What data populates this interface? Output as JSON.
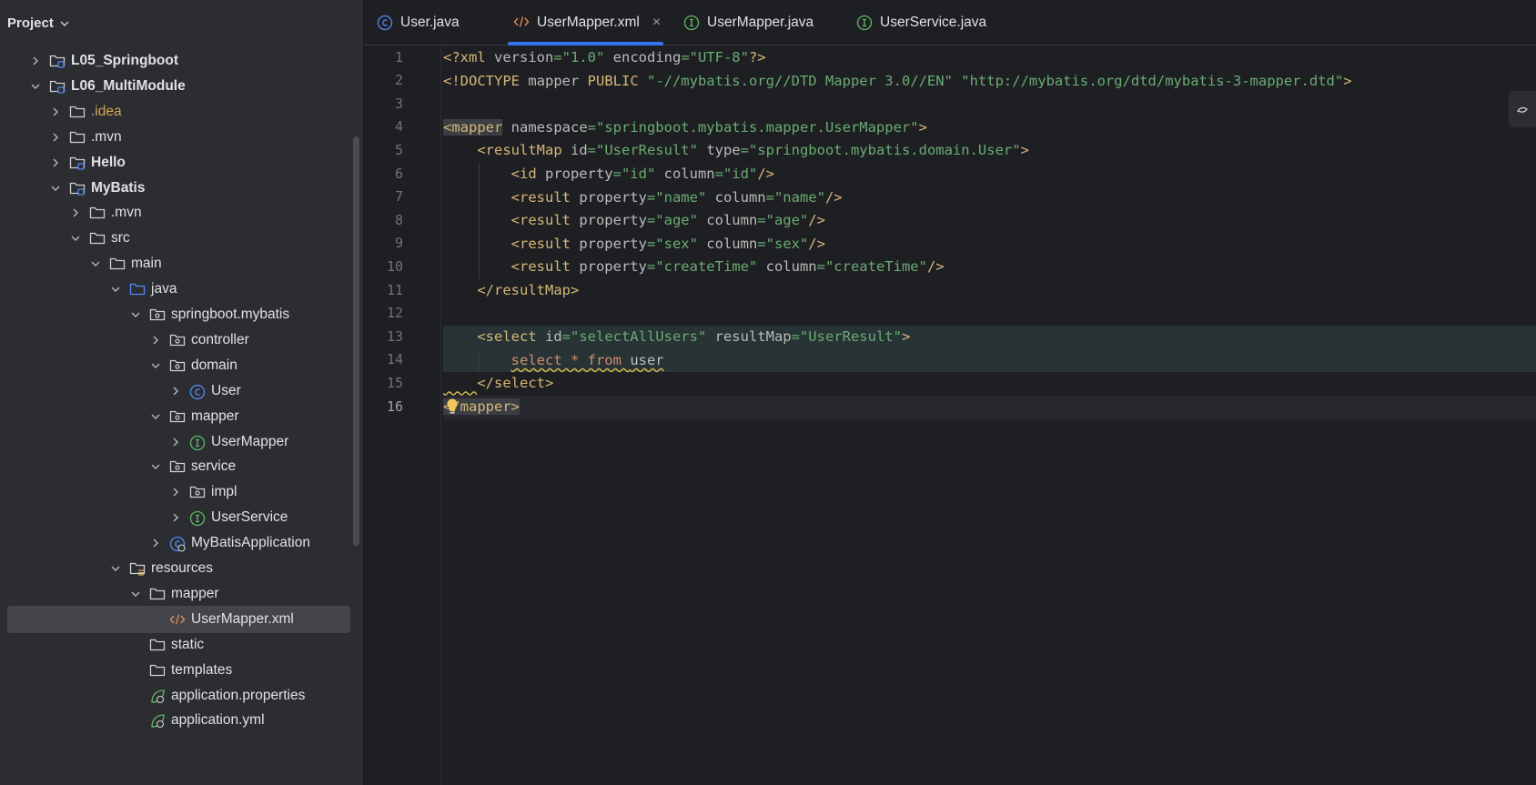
{
  "project": {
    "title": "Project",
    "tree": [
      {
        "label": "L05_Springboot",
        "depth": 1,
        "arrow": "right",
        "icon": "module-folder",
        "style": "bold"
      },
      {
        "label": "L06_MultiModule",
        "depth": 1,
        "arrow": "down",
        "icon": "module-folder",
        "style": "bold"
      },
      {
        "label": ".idea",
        "depth": 2,
        "arrow": "right",
        "icon": "folder",
        "style": "orange"
      },
      {
        "label": ".mvn",
        "depth": 2,
        "arrow": "right",
        "icon": "folder",
        "style": ""
      },
      {
        "label": "Hello",
        "depth": 2,
        "arrow": "right",
        "icon": "module-folder",
        "style": "bold"
      },
      {
        "label": "MyBatis",
        "depth": 2,
        "arrow": "down",
        "icon": "module-folder",
        "style": "bold"
      },
      {
        "label": ".mvn",
        "depth": 3,
        "arrow": "right",
        "icon": "folder",
        "style": ""
      },
      {
        "label": "src",
        "depth": 3,
        "arrow": "down",
        "icon": "folder",
        "style": ""
      },
      {
        "label": "main",
        "depth": 4,
        "arrow": "down",
        "icon": "folder",
        "style": ""
      },
      {
        "label": "java",
        "depth": 5,
        "arrow": "down",
        "icon": "source-folder",
        "style": ""
      },
      {
        "label": "springboot.mybatis",
        "depth": 6,
        "arrow": "down",
        "icon": "package",
        "style": ""
      },
      {
        "label": "controller",
        "depth": 7,
        "arrow": "right",
        "icon": "package",
        "style": ""
      },
      {
        "label": "domain",
        "depth": 7,
        "arrow": "down",
        "icon": "package",
        "style": ""
      },
      {
        "label": "User",
        "depth": 8,
        "arrow": "right",
        "icon": "class",
        "style": ""
      },
      {
        "label": "mapper",
        "depth": 7,
        "arrow": "down",
        "icon": "package",
        "style": ""
      },
      {
        "label": "UserMapper",
        "depth": 8,
        "arrow": "right",
        "icon": "interface",
        "style": ""
      },
      {
        "label": "service",
        "depth": 7,
        "arrow": "down",
        "icon": "package",
        "style": ""
      },
      {
        "label": "impl",
        "depth": 8,
        "arrow": "right",
        "icon": "package",
        "style": ""
      },
      {
        "label": "UserService",
        "depth": 8,
        "arrow": "right",
        "icon": "interface",
        "style": ""
      },
      {
        "label": "MyBatisApplication",
        "depth": 7,
        "arrow": "right",
        "icon": "spring-class",
        "style": ""
      },
      {
        "label": "resources",
        "depth": 5,
        "arrow": "down",
        "icon": "resources-folder",
        "style": ""
      },
      {
        "label": "mapper",
        "depth": 6,
        "arrow": "down",
        "icon": "folder",
        "style": ""
      },
      {
        "label": "UserMapper.xml",
        "depth": 7,
        "arrow": "none",
        "icon": "xml",
        "style": "",
        "selected": true
      },
      {
        "label": "static",
        "depth": 6,
        "arrow": "none",
        "icon": "folder",
        "style": ""
      },
      {
        "label": "templates",
        "depth": 6,
        "arrow": "none",
        "icon": "folder",
        "style": ""
      },
      {
        "label": "application.properties",
        "depth": 6,
        "arrow": "none",
        "icon": "spring-config",
        "style": ""
      },
      {
        "label": "application.yml",
        "depth": 6,
        "arrow": "none",
        "icon": "spring-config",
        "style": ""
      }
    ]
  },
  "tabs": [
    {
      "label": "User.java",
      "icon": "class",
      "active": false
    },
    {
      "label": "UserMapper.xml",
      "icon": "xml",
      "active": true,
      "close": "×"
    },
    {
      "label": "UserMapper.java",
      "icon": "interface",
      "active": false
    },
    {
      "label": "UserService.java",
      "icon": "interface",
      "active": false
    }
  ],
  "editor": {
    "line_numbers": [
      "1",
      "2",
      "3",
      "4",
      "5",
      "6",
      "7",
      "8",
      "9",
      "10",
      "11",
      "12",
      "13",
      "14",
      "15",
      "16"
    ],
    "current_line": 16,
    "lines": [
      [
        {
          "c": "t",
          "s": "<?xml "
        },
        {
          "c": "a",
          "s": "version"
        },
        {
          "c": "v",
          "s": "=\"1.0\" "
        },
        {
          "c": "a",
          "s": "encoding"
        },
        {
          "c": "v",
          "s": "=\"UTF-8\""
        },
        {
          "c": "t",
          "s": "?>"
        }
      ],
      [
        {
          "c": "t",
          "s": "<!DOCTYPE "
        },
        {
          "c": "a",
          "s": "mapper "
        },
        {
          "c": "t",
          "s": "PUBLIC "
        },
        {
          "c": "v",
          "s": "\"-//mybatis.org//DTD Mapper 3.0//EN\" \"http://mybatis.org/dtd/mybatis-3-mapper.dtd\""
        },
        {
          "c": "t",
          "s": ">"
        }
      ],
      [],
      [
        {
          "c": "t",
          "s": "<mapper",
          "hl": true
        },
        {
          "c": "a",
          "s": " namespace"
        },
        {
          "c": "v",
          "s": "=\"springboot.mybatis.mapper.UserMapper\""
        },
        {
          "c": "t",
          "s": ">"
        }
      ],
      [
        {
          "c": "p",
          "s": "    "
        },
        {
          "c": "t",
          "s": "<resultMap "
        },
        {
          "c": "a",
          "s": "id"
        },
        {
          "c": "v",
          "s": "=\"UserResult\" "
        },
        {
          "c": "a",
          "s": "type"
        },
        {
          "c": "v",
          "s": "=\"springboot.mybatis.domain.User\""
        },
        {
          "c": "t",
          "s": ">"
        }
      ],
      [
        {
          "c": "p",
          "s": "        "
        },
        {
          "c": "t",
          "s": "<id "
        },
        {
          "c": "a",
          "s": "property"
        },
        {
          "c": "v",
          "s": "=\"id\" "
        },
        {
          "c": "a",
          "s": "column"
        },
        {
          "c": "v",
          "s": "=\"id\""
        },
        {
          "c": "t",
          "s": "/>"
        }
      ],
      [
        {
          "c": "p",
          "s": "        "
        },
        {
          "c": "t",
          "s": "<result "
        },
        {
          "c": "a",
          "s": "property"
        },
        {
          "c": "v",
          "s": "=\"name\" "
        },
        {
          "c": "a",
          "s": "column"
        },
        {
          "c": "v",
          "s": "=\"name\""
        },
        {
          "c": "t",
          "s": "/>"
        }
      ],
      [
        {
          "c": "p",
          "s": "        "
        },
        {
          "c": "t",
          "s": "<result "
        },
        {
          "c": "a",
          "s": "property"
        },
        {
          "c": "v",
          "s": "=\"age\" "
        },
        {
          "c": "a",
          "s": "column"
        },
        {
          "c": "v",
          "s": "=\"age\""
        },
        {
          "c": "t",
          "s": "/>"
        }
      ],
      [
        {
          "c": "p",
          "s": "        "
        },
        {
          "c": "t",
          "s": "<result "
        },
        {
          "c": "a",
          "s": "property"
        },
        {
          "c": "v",
          "s": "=\"sex\" "
        },
        {
          "c": "a",
          "s": "column"
        },
        {
          "c": "v",
          "s": "=\"sex\""
        },
        {
          "c": "t",
          "s": "/>"
        }
      ],
      [
        {
          "c": "p",
          "s": "        "
        },
        {
          "c": "t",
          "s": "<result "
        },
        {
          "c": "a",
          "s": "property"
        },
        {
          "c": "v",
          "s": "=\"createTime\" "
        },
        {
          "c": "a",
          "s": "column"
        },
        {
          "c": "v",
          "s": "=\"createTime\""
        },
        {
          "c": "t",
          "s": "/>"
        }
      ],
      [
        {
          "c": "p",
          "s": "    "
        },
        {
          "c": "t",
          "s": "</resultMap>"
        }
      ],
      [],
      [
        {
          "c": "p",
          "s": "    "
        },
        {
          "c": "t",
          "s": "<select "
        },
        {
          "c": "a",
          "s": "id"
        },
        {
          "c": "v",
          "s": "=\"selectAllUsers\" "
        },
        {
          "c": "a",
          "s": "resultMap"
        },
        {
          "c": "v",
          "s": "=\"UserResult\""
        },
        {
          "c": "t",
          "s": ">"
        }
      ],
      [
        {
          "c": "p",
          "s": "        "
        },
        {
          "c": "k",
          "s": "select * from ",
          "sq": true
        },
        {
          "c": "p",
          "s": "user",
          "sq": true
        }
      ],
      [
        {
          "c": "p",
          "s": "    ",
          "sq": true
        },
        {
          "c": "t",
          "s": "</select>"
        }
      ],
      [
        {
          "c": "t",
          "s": "</mapper>",
          "hl": true
        }
      ]
    ],
    "highlight_lines": [
      13,
      14
    ],
    "guides": [
      {
        "line": 6,
        "col": 4
      },
      {
        "line": 7,
        "col": 4
      },
      {
        "line": 8,
        "col": 4
      },
      {
        "line": 9,
        "col": 4
      },
      {
        "line": 10,
        "col": 4
      },
      {
        "line": 14,
        "col": 4
      }
    ]
  },
  "colors": {
    "accent": "#3574f0",
    "tag": "#d5b778",
    "attr": "#bababa",
    "value": "#6aab73",
    "keyword": "#cf8e6d"
  }
}
